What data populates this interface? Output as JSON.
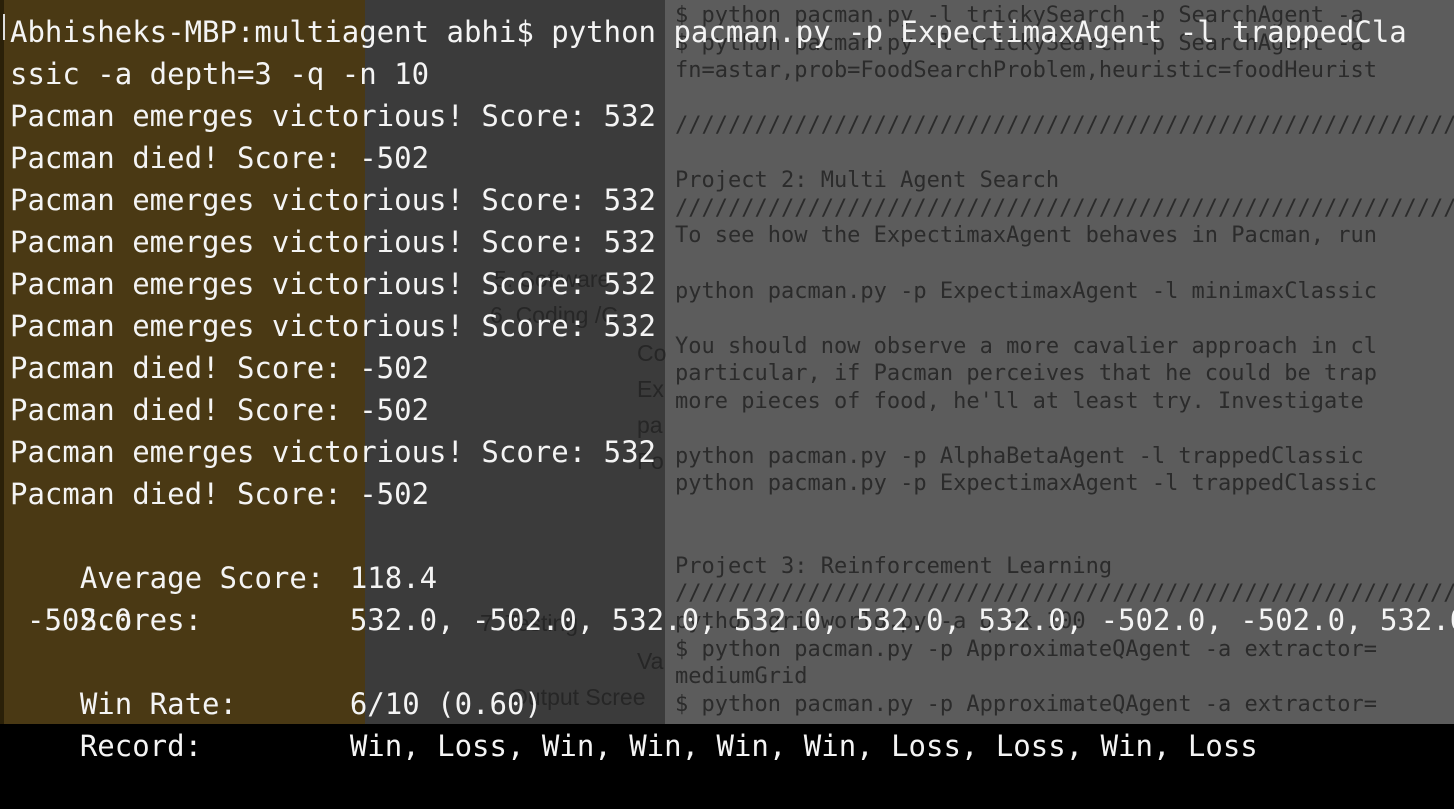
{
  "terminal": {
    "command_line_1": "Abhisheks-MBP:multiagent abhi$ python pacman.py -p ExpectimaxAgent -l trappedCla",
    "command_line_2": "ssic -a depth=3 -q -n 10",
    "output": [
      "Pacman emerges victorious! Score: 532",
      "Pacman died! Score: -502",
      "Pacman emerges victorious! Score: 532",
      "Pacman emerges victorious! Score: 532",
      "Pacman emerges victorious! Score: 532",
      "Pacman emerges victorious! Score: 532",
      "Pacman died! Score: -502",
      "Pacman died! Score: -502",
      "Pacman emerges victorious! Score: 532",
      "Pacman died! Score: -502"
    ],
    "summary": {
      "average_label": "Average Score:",
      "average_value": "118.4",
      "scores_label": "Scores:",
      "scores_value": "532.0, -502.0, 532.0, 532.0, 532.0, 532.0, -502.0, -502.0, 532.0,",
      "scores_wrap": "-502.0",
      "winrate_label": "Win Rate:",
      "winrate_value": "6/10 (0.60)",
      "record_label": "Record:",
      "record_value": "Win, Loss, Win, Win, Win, Win, Loss, Loss, Win, Loss"
    }
  },
  "background_doc": {
    "line_top_a": "$ python pacman.py -l trickySearch -p SearchAgent -a",
    "line_top_b": "$ python pacman.py -l trickySearch -p SearchAgent -a",
    "line_fn": "fn=astar,prob=FoodSearchProblem,heuristic=foodHeurist",
    "project2_title": "Project 2: Multi Agent Search",
    "project2_intro": "To see how the ExpectimaxAgent behaves in Pacman, run",
    "cmd_minimax": "python pacman.py -p ExpectimaxAgent -l minimaxClassic",
    "para_1": "You should now observe a more cavalier approach in cl",
    "para_2": "particular, if Pacman perceives that he could be trap",
    "para_3": "more pieces of food, he'll at least try. Investigate",
    "cmd_alphabeta": "python pacman.py -p AlphaBetaAgent -l trappedClassic",
    "cmd_expectimax": "python pacman.py -p ExpectimaxAgent -l trappedClassic",
    "project3_title": "Project 3: Reinforcement Learning",
    "cmd_gridworld": "python gridworld.py -a q -k 100",
    "cmd_approxq": "$ python pacman.py -p ApproximateQAgent -a extractor=",
    "medium_grid": "mediumGrid",
    "cmd_approxq_b": "$ python pacman.py -p ApproximateQAgent -a extractor=",
    "slashes": "////////////////////////////////////////////////////////////////"
  },
  "background_outline": {
    "item_5": "5. Software",
    "item_6": "6. Coding /C",
    "sub_co": "Co",
    "sub_ex": "Ex",
    "sub_pa": "pa",
    "sub_fo": "Fo",
    "item_7": "7. Testing",
    "sub_va": "Va",
    "item_output": "Output Scree"
  },
  "colors": {
    "text": "#f4f4f4",
    "left_panel": "#4a3914",
    "right_panel": "#5c5c5c",
    "spell_underline": "#b03030"
  }
}
